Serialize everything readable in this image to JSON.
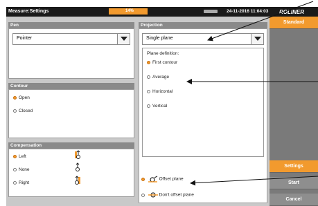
{
  "topbar": {
    "title": "Measure:Settings",
    "progress_label": "14%",
    "datetime": "24-11-2016 11:04:03"
  },
  "brand": {
    "name": "ROLINER"
  },
  "pen": {
    "header": "Pen",
    "value": "Pointer"
  },
  "contour": {
    "header": "Contour",
    "options": [
      {
        "label": "Open",
        "selected": true
      },
      {
        "label": "Closed",
        "selected": false
      }
    ]
  },
  "compensation": {
    "header": "Compensation",
    "options": [
      {
        "label": "Left",
        "selected": true
      },
      {
        "label": "None",
        "selected": false
      },
      {
        "label": "Right",
        "selected": false
      }
    ]
  },
  "projection": {
    "header": "Projection",
    "value": "Single plane",
    "plane_definition_label": "Plane definition:",
    "plane_options": [
      {
        "label": "First contour",
        "selected": true
      },
      {
        "label": "Average",
        "selected": false
      },
      {
        "label": "Horizontal",
        "selected": false
      },
      {
        "label": "Vertical",
        "selected": false
      }
    ],
    "offset_options": [
      {
        "label": "Offset plane",
        "selected": true
      },
      {
        "label": "Don't offset plane",
        "selected": false
      }
    ]
  },
  "right_panel": {
    "standard": "Standard",
    "settings": "Settings",
    "start": "Start",
    "cancel": "Cancel"
  },
  "colors": {
    "accent": "#f29a2e",
    "panel_bg": "#c9c9c9",
    "header_bg": "#8a8a8a"
  }
}
